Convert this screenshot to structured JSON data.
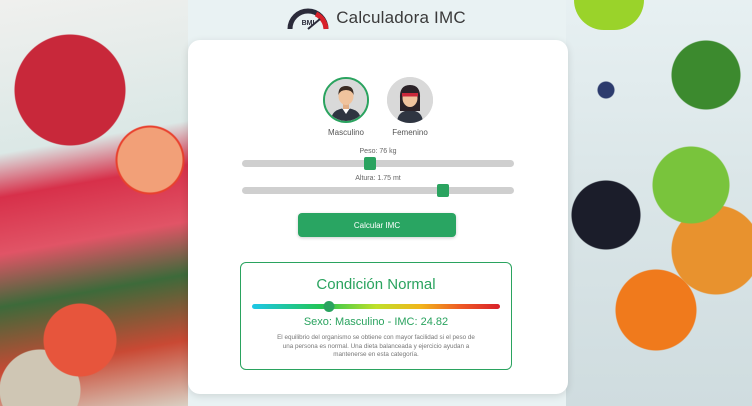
{
  "header": {
    "title": "Calculadora IMC",
    "logo_text": "BMI"
  },
  "genders": [
    {
      "label": "Masculino",
      "selected": true
    },
    {
      "label": "Femenino",
      "selected": false
    }
  ],
  "peso": {
    "label": "Peso: 76 kg",
    "value_fraction": 0.47
  },
  "altura": {
    "label": "Altura: 1.75 mt",
    "value_fraction": 0.74
  },
  "calc_button": "Calcular IMC",
  "result": {
    "condition": "Condición Normal",
    "scale_fraction": 0.31,
    "summary": "Sexo: Masculino - IMC: 24.82",
    "description": "El equilibrio del organismo se obtiene con mayor facilidad si el peso de una persona es normal. Una dieta balanceada y ejercicio ayudan a mantenerse en esta categoría."
  },
  "colors": {
    "accent": "#2aa35f",
    "button": "#29a562"
  },
  "icons": [
    "bmi-gauge-icon",
    "male-avatar-icon",
    "female-avatar-icon"
  ]
}
